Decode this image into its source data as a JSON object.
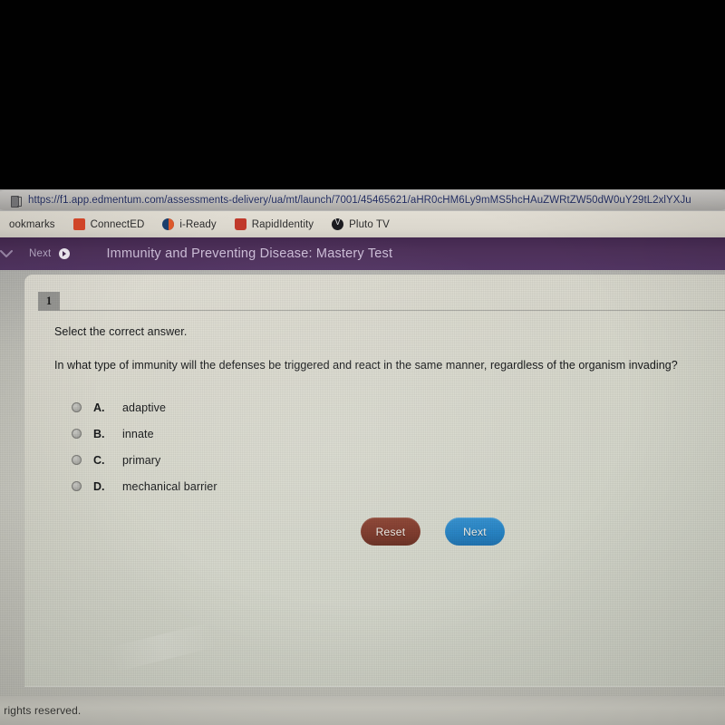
{
  "browser": {
    "url": "https://f1.app.edmentum.com/assessments-delivery/ua/mt/launch/7001/45465621/aHR0cHM6Ly9mMS5hcHAuZWRtZW50dW0uY29tL2xlYXJu",
    "url_icon": "document-icon",
    "bookmarks": [
      {
        "label": "ookmarks",
        "icon": "folder-icon",
        "icon_class": "folder-only"
      },
      {
        "label": "ConnectED",
        "icon": "connected-icon",
        "icon_class": "connected"
      },
      {
        "label": "i-Ready",
        "icon": "iready-icon",
        "icon_class": "iready"
      },
      {
        "label": "RapidIdentity",
        "icon": "rapididentity-icon",
        "icon_class": "rapid"
      },
      {
        "label": "Pluto TV",
        "icon": "pluto-tv-icon",
        "icon_class": "pluto"
      }
    ]
  },
  "app_header": {
    "chevron_icon": "chevron-down-icon",
    "next_label": "Next",
    "next_icon": "arrow-right-circle-icon",
    "title": "Immunity and Preventing Disease: Mastery Test",
    "background_color": "#4d3059"
  },
  "question": {
    "number": "1",
    "instruction": "Select the correct answer.",
    "stem": "In what type of immunity will the defenses be triggered and react in the same manner, regardless of the organism invading?",
    "options": [
      {
        "letter": "A.",
        "text": "adaptive",
        "selected": false
      },
      {
        "letter": "B.",
        "text": "innate",
        "selected": false
      },
      {
        "letter": "C.",
        "text": "primary",
        "selected": false
      },
      {
        "letter": "D.",
        "text": "mechanical barrier",
        "selected": false
      }
    ]
  },
  "actions": {
    "reset_label": "Reset",
    "reset_color": "#7a3223",
    "next_label": "Next",
    "next_color": "#2080c3"
  },
  "footer": {
    "text": "l rights reserved."
  }
}
